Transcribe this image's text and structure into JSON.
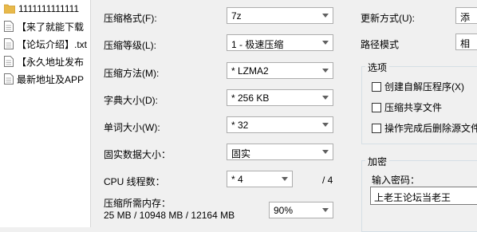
{
  "file_list": {
    "items": [
      {
        "name": "1111111111111",
        "icon": "folder-icon"
      },
      {
        "name": "【来了就能下载",
        "icon": "text-file-icon"
      },
      {
        "name": "【论坛介绍】.txt",
        "icon": "text-file-icon"
      },
      {
        "name": "【永久地址发布",
        "icon": "text-file-icon"
      },
      {
        "name": "最新地址及APP",
        "icon": "text-file-icon"
      }
    ]
  },
  "settings": {
    "format_label": "压缩格式(F):",
    "format_value": "7z",
    "level_label": "压缩等级(L):",
    "level_value": "1 - 极速压缩",
    "method_label": "压缩方法(M):",
    "method_value": "* LZMA2",
    "dict_label": "字典大小(D):",
    "dict_value": "* 256 KB",
    "word_label": "单词大小(W):",
    "word_value": "* 32",
    "solid_label": "固实数据大小：",
    "solid_value": "固实",
    "threads_label": "CPU 线程数：",
    "threads_value": "* 4",
    "threads_total": "/ 4",
    "memory_label": "压缩所需内存：",
    "memory_values": "25 MB / 10948 MB / 12164 MB",
    "memory_percent": "90%"
  },
  "right": {
    "update_label": "更新方式(U):",
    "update_value": "添",
    "path_label": "路径模式",
    "path_value": "相",
    "options_title": "选项",
    "opt_sfx": "创建自解压程序(X)",
    "opt_shared": "压缩共享文件",
    "opt_delete": "操作完成后删除源文件",
    "encrypt_title": "加密",
    "password_label": "输入密码：",
    "password_value": "上老王论坛当老王"
  },
  "colors": {
    "folder": "#e8b94a",
    "background": "#f0f0f0",
    "group_border": "#d5dfe5"
  }
}
